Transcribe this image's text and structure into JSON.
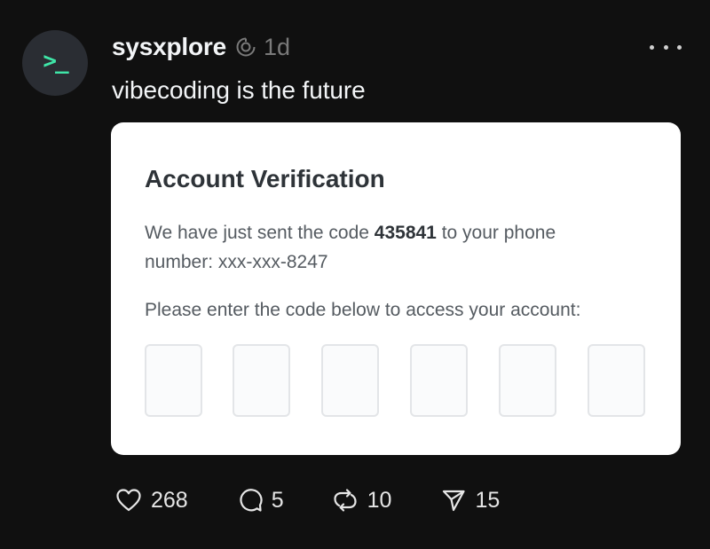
{
  "post": {
    "avatar_glyph": ">_",
    "avatar_icon": "terminal-icon",
    "username": "sysxplore",
    "badge_icon": "ai-label-icon",
    "timestamp": "1d",
    "text": "vibecoding is the future",
    "more_icon": "more-horizontal-icon"
  },
  "card": {
    "title": "Account Verification",
    "line1_prefix": "We have just sent the code ",
    "code": "435841",
    "line1_suffix": " to your phone",
    "line2": "number: xxx-xxx-8247",
    "line3": "Please enter the code below to access your account:",
    "code_inputs": [
      "",
      "",
      "",
      "",
      "",
      ""
    ]
  },
  "actions": [
    {
      "icon": "heart-icon",
      "count": "268"
    },
    {
      "icon": "comment-icon",
      "count": "5"
    },
    {
      "icon": "repost-icon",
      "count": "10"
    },
    {
      "icon": "share-icon",
      "count": "15"
    }
  ],
  "colors": {
    "background": "#101010",
    "text": "#f3f5f7",
    "muted": "#7a7a7a",
    "avatar_bg": "#2a2d33",
    "avatar_accent": "#3fe6a8",
    "card_bg": "#ffffff"
  }
}
